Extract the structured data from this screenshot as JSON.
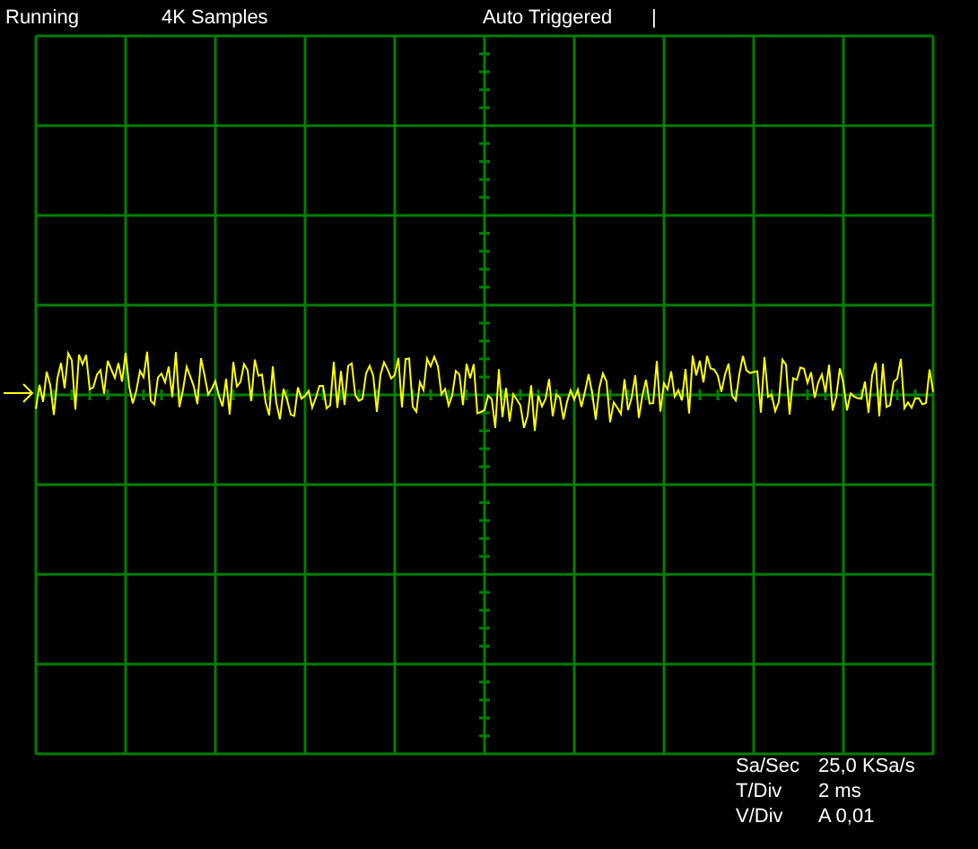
{
  "status_bar": {
    "run_state": "Running",
    "samples": "4K Samples",
    "trigger_mode": "Auto Triggered",
    "trigger_marker": "|"
  },
  "readouts": [
    {
      "label": "Sa/Sec",
      "value": "25,0 KSa/s"
    },
    {
      "label": "T/Div",
      "value": "2 ms"
    },
    {
      "label": "V/Div",
      "value": "A 0,01"
    }
  ]
}
